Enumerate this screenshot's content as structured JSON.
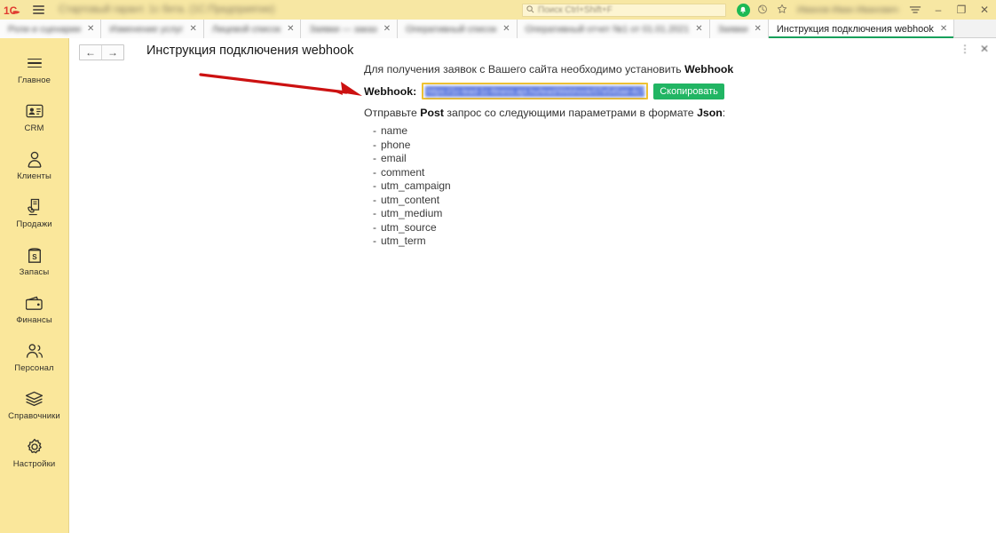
{
  "titlebar": {
    "logo": "1c-logo",
    "app_title": "Стартовый гарант. 1с бета. (1С:Предприятие)",
    "search_placeholder": "Поиск Ctrl+Shift+F",
    "user_label": "Иванов Иван Иванович",
    "icons": {
      "menu": "hamburger-menu-icon",
      "notifications": "bell-icon",
      "history": "history-clock-icon",
      "favorites": "star-icon",
      "main_menu": "main-menu-icon",
      "minimize": "–",
      "maximize": "❐",
      "close": "✕"
    }
  },
  "tabs": [
    {
      "label": "Роли и сценарии",
      "active": false,
      "close": "✕"
    },
    {
      "label": "Изменение услуг",
      "active": false,
      "close": "✕"
    },
    {
      "label": "Лицевой список",
      "active": false,
      "close": "✕"
    },
    {
      "label": "Заявки — заказ",
      "active": false,
      "close": "✕"
    },
    {
      "label": "Оперативный список",
      "active": false,
      "close": "✕"
    },
    {
      "label": "Оперативный отчет №1 от 01.01.2021",
      "active": false,
      "close": "✕"
    },
    {
      "label": "Заявки",
      "active": false,
      "close": "✕"
    },
    {
      "label": "Инструкция подключения webhook",
      "active": true,
      "close": "✕"
    }
  ],
  "sidebar": {
    "items": [
      {
        "label": "Главное",
        "icon": "hamburger-menu-icon"
      },
      {
        "label": "CRM",
        "icon": "contact-card-icon"
      },
      {
        "label": "Клиенты",
        "icon": "person-icon"
      },
      {
        "label": "Продажи",
        "icon": "hand-document-icon"
      },
      {
        "label": "Запасы",
        "icon": "box-money-icon"
      },
      {
        "label": "Финансы",
        "icon": "wallet-icon"
      },
      {
        "label": "Персонал",
        "icon": "people-icon"
      },
      {
        "label": "Справочники",
        "icon": "stack-layers-icon"
      },
      {
        "label": "Настройки",
        "icon": "gear-icon"
      }
    ]
  },
  "content": {
    "nav_back": "←",
    "nav_forward": "→",
    "page_title": "Инструкция подключения webhook",
    "more_icon": "⋮",
    "close_icon": "✕",
    "intro_prefix": "Для получения заявок с Вашего сайта необходимо установить ",
    "intro_bold": "Webhook",
    "webhook_label": "Webhook:",
    "webhook_value": "https://1c-lead-1c-fitness.api.hu/lead/Webhook/07e545ae-4c74",
    "copy_button": "Скопировать",
    "send_prefix": "Отправьте ",
    "send_bold1": "Post",
    "send_middle": " запрос со следующими параметрами в формате ",
    "send_bold2": "Json",
    "send_suffix": ":",
    "params": [
      "name",
      "phone",
      "email",
      "comment",
      "utm_campaign",
      "utm_content",
      "utm_medium",
      "utm_source",
      "utm_term"
    ],
    "annotation_arrow": "red-pointer-arrow"
  },
  "colors": {
    "sidebar_bg": "#FAE79B",
    "titlebar_bg": "#F7E7A3",
    "accent_green": "#21B563",
    "active_tab_underline": "#17A05B",
    "input_border": "#F0C330",
    "selection_blue": "#3B5DD6",
    "annotation_red": "#CC1111",
    "logo_red": "#E03C31"
  }
}
